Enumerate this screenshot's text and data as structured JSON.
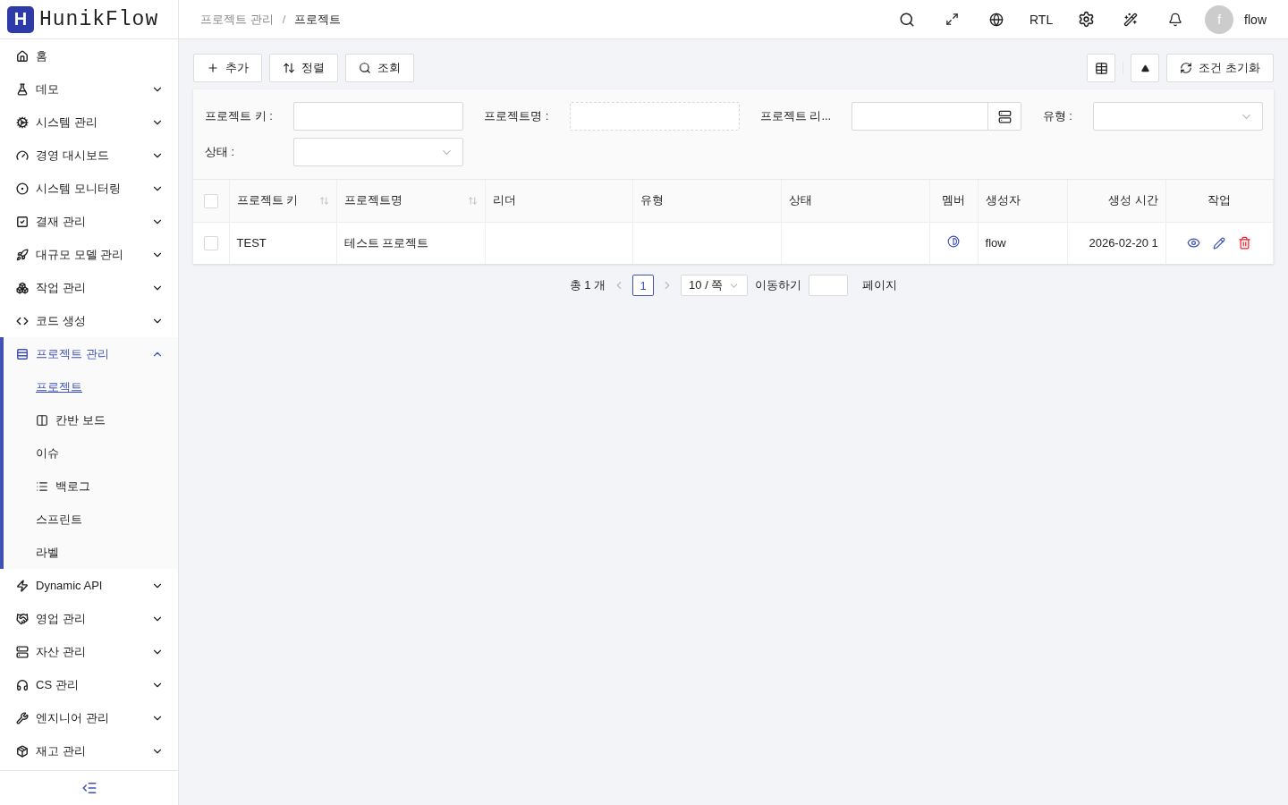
{
  "header": {
    "logo_letter": "H",
    "app_name": "HunikFlow",
    "breadcrumb": [
      "프로젝트 관리",
      "프로젝트"
    ],
    "separator": "/",
    "rtl": "RTL",
    "avatar_letter": "f",
    "user": "flow"
  },
  "sidebar": {
    "items": [
      {
        "label": "홈",
        "kind": "link",
        "expanded": false,
        "selected": false
      },
      {
        "label": "데모",
        "kind": "group",
        "expanded": false,
        "selected": false
      },
      {
        "label": "시스템 관리",
        "kind": "group",
        "expanded": false,
        "selected": false
      },
      {
        "label": "경영 대시보드",
        "kind": "group",
        "expanded": false,
        "selected": false
      },
      {
        "label": "시스템 모니터링",
        "kind": "group",
        "expanded": false,
        "selected": false
      },
      {
        "label": "결재 관리",
        "kind": "group",
        "expanded": false,
        "selected": false
      },
      {
        "label": "대규모 모델 관리",
        "kind": "group",
        "expanded": false,
        "selected": false
      },
      {
        "label": "작업 관리",
        "kind": "group",
        "expanded": false,
        "selected": false
      },
      {
        "label": "코드 생성",
        "kind": "group",
        "expanded": false,
        "selected": false
      },
      {
        "label": "프로젝트 관리",
        "kind": "group",
        "expanded": true,
        "selected": true,
        "children": [
          {
            "label": "프로젝트",
            "selected": true
          },
          {
            "label": "칸반 보드",
            "selected": false
          },
          {
            "label": "이슈",
            "selected": false
          },
          {
            "label": "백로그",
            "selected": false
          },
          {
            "label": "스프린트",
            "selected": false
          },
          {
            "label": "라벨",
            "selected": false
          }
        ]
      },
      {
        "label": "Dynamic API",
        "kind": "group",
        "expanded": false,
        "selected": false
      },
      {
        "label": "영업 관리",
        "kind": "group",
        "expanded": false,
        "selected": false
      },
      {
        "label": "자산 관리",
        "kind": "group",
        "expanded": false,
        "selected": false
      },
      {
        "label": "CS 관리",
        "kind": "group",
        "expanded": false,
        "selected": false
      },
      {
        "label": "엔지니어 관리",
        "kind": "group",
        "expanded": false,
        "selected": false
      },
      {
        "label": "재고 관리",
        "kind": "group",
        "expanded": false,
        "selected": false
      }
    ]
  },
  "toolbar": {
    "left": [
      "추가",
      "정렬",
      "조회"
    ],
    "reset": "조건 초기화"
  },
  "filters": [
    {
      "label": "프로젝트 키 :",
      "kind": "text"
    },
    {
      "label": "프로젝트명 :",
      "kind": "dashed"
    },
    {
      "label": "프로젝트 리...",
      "kind": "picker"
    },
    {
      "label": "유형 :",
      "kind": "select"
    },
    {
      "label": "상태 :",
      "kind": "select"
    }
  ],
  "table": {
    "select_all_checked": false,
    "columns": [
      {
        "label": "프로젝트 키",
        "sortable": true
      },
      {
        "label": "프로젝트명",
        "sortable": true
      },
      {
        "label": "리더",
        "sortable": false
      },
      {
        "label": "유형",
        "sortable": false
      },
      {
        "label": "상태",
        "sortable": false
      },
      {
        "label": "멤버",
        "sortable": false
      },
      {
        "label": "생성자",
        "sortable": false
      },
      {
        "label": "생성 시간",
        "sortable": false
      },
      {
        "label": "작업",
        "sortable": false
      }
    ],
    "rows": [
      {
        "checked": false,
        "cells": [
          "TEST",
          "테스트 프로젝트",
          "",
          "",
          "",
          "",
          "flow",
          "2026-02-20 1"
        ]
      }
    ]
  },
  "pagination": {
    "total": "총 1 개",
    "pages": [
      {
        "label": "1",
        "selected": true
      }
    ],
    "page_size": "10 / 쪽",
    "jump_label": "이동하기",
    "page_word": "페이지"
  }
}
